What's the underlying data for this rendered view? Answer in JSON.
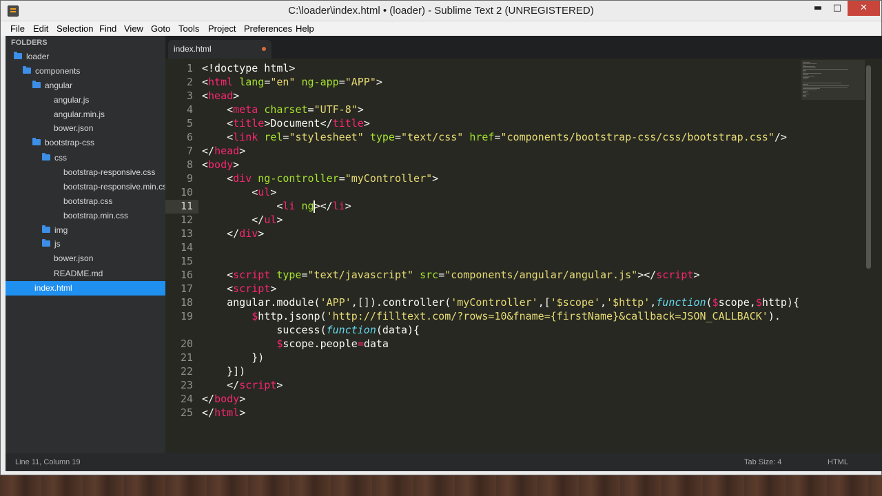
{
  "window": {
    "title": "C:\\loader\\index.html • (loader) - Sublime Text 2 (UNREGISTERED)",
    "minimize_glyph": "▬",
    "maximize_glyph": "□",
    "close_glyph": "✕"
  },
  "menu": {
    "items": [
      "File",
      "Edit",
      "Selection",
      "Find",
      "View",
      "Goto",
      "Tools",
      "Project",
      "Preferences",
      "Help"
    ]
  },
  "sidebar": {
    "header": "FOLDERS",
    "items": [
      {
        "label": "loader",
        "type": "folder"
      },
      {
        "label": "components",
        "type": "folder"
      },
      {
        "label": "angular",
        "type": "folder"
      },
      {
        "label": "angular.js",
        "type": "file"
      },
      {
        "label": "angular.min.js",
        "type": "file"
      },
      {
        "label": "bower.json",
        "type": "file"
      },
      {
        "label": "bootstrap-css",
        "type": "folder"
      },
      {
        "label": "css",
        "type": "folder"
      },
      {
        "label": "bootstrap-responsive.css",
        "type": "file"
      },
      {
        "label": "bootstrap-responsive.min.css",
        "type": "file"
      },
      {
        "label": "bootstrap.css",
        "type": "file"
      },
      {
        "label": "bootstrap.min.css",
        "type": "file"
      },
      {
        "label": "img",
        "type": "folder"
      },
      {
        "label": "js",
        "type": "folder"
      },
      {
        "label": "bower.json",
        "type": "file"
      },
      {
        "label": "README.md",
        "type": "file"
      },
      {
        "label": "index.html",
        "type": "file",
        "selected": true
      }
    ]
  },
  "tab": {
    "label": "index.html",
    "dirty": true
  },
  "editor": {
    "gutter": [
      "1",
      "2",
      "3",
      "4",
      "5",
      "6",
      "7",
      "8",
      "9",
      "10",
      "11",
      "12",
      "13",
      "14",
      "15",
      "16",
      "17",
      "18",
      "19",
      "",
      "20",
      "21",
      "22",
      "23",
      "24",
      "25"
    ],
    "lines": [
      [
        [
          "<!doctype html>",
          "plain"
        ]
      ],
      [
        [
          "<",
          "plain"
        ],
        [
          "html",
          "tag"
        ],
        [
          " ",
          "plain"
        ],
        [
          "lang",
          "attr"
        ],
        [
          "=",
          "plain"
        ],
        [
          "\"en\"",
          "str"
        ],
        [
          " ",
          "plain"
        ],
        [
          "ng-app",
          "attr"
        ],
        [
          "=",
          "plain"
        ],
        [
          "\"APP\"",
          "str"
        ],
        [
          ">",
          "plain"
        ]
      ],
      [
        [
          "<",
          "plain"
        ],
        [
          "head",
          "tag"
        ],
        [
          ">",
          "plain"
        ]
      ],
      [
        [
          "    <",
          "plain"
        ],
        [
          "meta",
          "tag"
        ],
        [
          " ",
          "plain"
        ],
        [
          "charset",
          "attr"
        ],
        [
          "=",
          "plain"
        ],
        [
          "\"UTF-8\"",
          "str"
        ],
        [
          ">",
          "plain"
        ]
      ],
      [
        [
          "    <",
          "plain"
        ],
        [
          "title",
          "tag"
        ],
        [
          ">Document</",
          "plain"
        ],
        [
          "title",
          "tag"
        ],
        [
          ">",
          "plain"
        ]
      ],
      [
        [
          "    <",
          "plain"
        ],
        [
          "link",
          "tag"
        ],
        [
          " ",
          "plain"
        ],
        [
          "rel",
          "attr"
        ],
        [
          "=",
          "plain"
        ],
        [
          "\"stylesheet\"",
          "str"
        ],
        [
          " ",
          "plain"
        ],
        [
          "type",
          "attr"
        ],
        [
          "=",
          "plain"
        ],
        [
          "\"text/css\"",
          "str"
        ],
        [
          " ",
          "plain"
        ],
        [
          "href",
          "attr"
        ],
        [
          "=",
          "plain"
        ],
        [
          "\"components/bootstrap-css/css/bootstrap.css\"",
          "str"
        ],
        [
          "/>",
          "plain"
        ]
      ],
      [
        [
          "</",
          "plain"
        ],
        [
          "head",
          "tag"
        ],
        [
          ">",
          "plain"
        ]
      ],
      [
        [
          "<",
          "plain"
        ],
        [
          "body",
          "tag"
        ],
        [
          ">",
          "plain"
        ]
      ],
      [
        [
          "    <",
          "plain"
        ],
        [
          "div",
          "tag"
        ],
        [
          " ",
          "plain"
        ],
        [
          "ng-controller",
          "attr"
        ],
        [
          "=",
          "plain"
        ],
        [
          "\"myController\"",
          "str"
        ],
        [
          ">",
          "plain"
        ]
      ],
      [
        [
          "        <",
          "plain"
        ],
        [
          "ul",
          "tag"
        ],
        [
          ">",
          "plain"
        ]
      ],
      [
        [
          "            <",
          "plain"
        ],
        [
          "li",
          "tag"
        ],
        [
          " ",
          "plain"
        ],
        [
          "ng",
          "attr"
        ],
        [
          "></",
          "plain"
        ],
        [
          "li",
          "tag"
        ],
        [
          ">",
          "plain"
        ]
      ],
      [
        [
          "        </",
          "plain"
        ],
        [
          "ul",
          "tag"
        ],
        [
          ">",
          "plain"
        ]
      ],
      [
        [
          "    </",
          "plain"
        ],
        [
          "div",
          "tag"
        ],
        [
          ">",
          "plain"
        ]
      ],
      [
        [
          "",
          "plain"
        ]
      ],
      [
        [
          "",
          "plain"
        ]
      ],
      [
        [
          "    <",
          "plain"
        ],
        [
          "script",
          "tag"
        ],
        [
          " ",
          "plain"
        ],
        [
          "type",
          "attr"
        ],
        [
          "=",
          "plain"
        ],
        [
          "\"text/javascript\"",
          "str"
        ],
        [
          " ",
          "plain"
        ],
        [
          "src",
          "attr"
        ],
        [
          "=",
          "plain"
        ],
        [
          "\"components/angular/angular.js\"",
          "str"
        ],
        [
          "></",
          "plain"
        ],
        [
          "script",
          "tag"
        ],
        [
          ">",
          "plain"
        ]
      ],
      [
        [
          "    <",
          "plain"
        ],
        [
          "script",
          "tag"
        ],
        [
          ">",
          "plain"
        ]
      ],
      [
        [
          "    angular.module(",
          "plain"
        ],
        [
          "'APP'",
          "str"
        ],
        [
          ",[]).controller(",
          "plain"
        ],
        [
          "'myController'",
          "str"
        ],
        [
          ",[",
          "plain"
        ],
        [
          "'$scope'",
          "str"
        ],
        [
          ",",
          "plain"
        ],
        [
          "'$http'",
          "str"
        ],
        [
          ",",
          "plain"
        ],
        [
          "function",
          "kw"
        ],
        [
          "(",
          "plain"
        ],
        [
          "$",
          "var"
        ],
        [
          "scope,",
          "plain"
        ],
        [
          "$",
          "var"
        ],
        [
          "http){",
          "plain"
        ]
      ],
      [
        [
          "        ",
          "plain"
        ],
        [
          "$",
          "var"
        ],
        [
          "http.jsonp(",
          "plain"
        ],
        [
          "'http://filltext.com/?rows=10&fname={firstName}&callback=JSON_CALLBACK'",
          "str"
        ],
        [
          ").",
          "plain"
        ]
      ],
      [
        [
          "            success(",
          "plain"
        ],
        [
          "function",
          "kw"
        ],
        [
          "(data){",
          "plain"
        ]
      ],
      [
        [
          "            ",
          "plain"
        ],
        [
          "$",
          "var"
        ],
        [
          "scope.people",
          "plain"
        ],
        [
          "=",
          "var"
        ],
        [
          "data",
          "plain"
        ]
      ],
      [
        [
          "        })",
          "plain"
        ]
      ],
      [
        [
          "    }])",
          "plain"
        ]
      ],
      [
        [
          "    </",
          "plain"
        ],
        [
          "script",
          "tag"
        ],
        [
          ">",
          "plain"
        ]
      ],
      [
        [
          "</",
          "plain"
        ],
        [
          "body",
          "tag"
        ],
        [
          ">",
          "plain"
        ]
      ],
      [
        [
          "</",
          "plain"
        ],
        [
          "html",
          "tag"
        ],
        [
          ">",
          "plain"
        ]
      ]
    ]
  },
  "status": {
    "position": "Line 11, Column 19",
    "tab_size": "Tab Size: 4",
    "syntax": "HTML"
  },
  "colors": {
    "tag": "#f92672",
    "attr": "#a6e22e",
    "str": "#e6db74",
    "kw": "#66d9ef",
    "background": "#272822",
    "selection": "#1f8ff0"
  }
}
